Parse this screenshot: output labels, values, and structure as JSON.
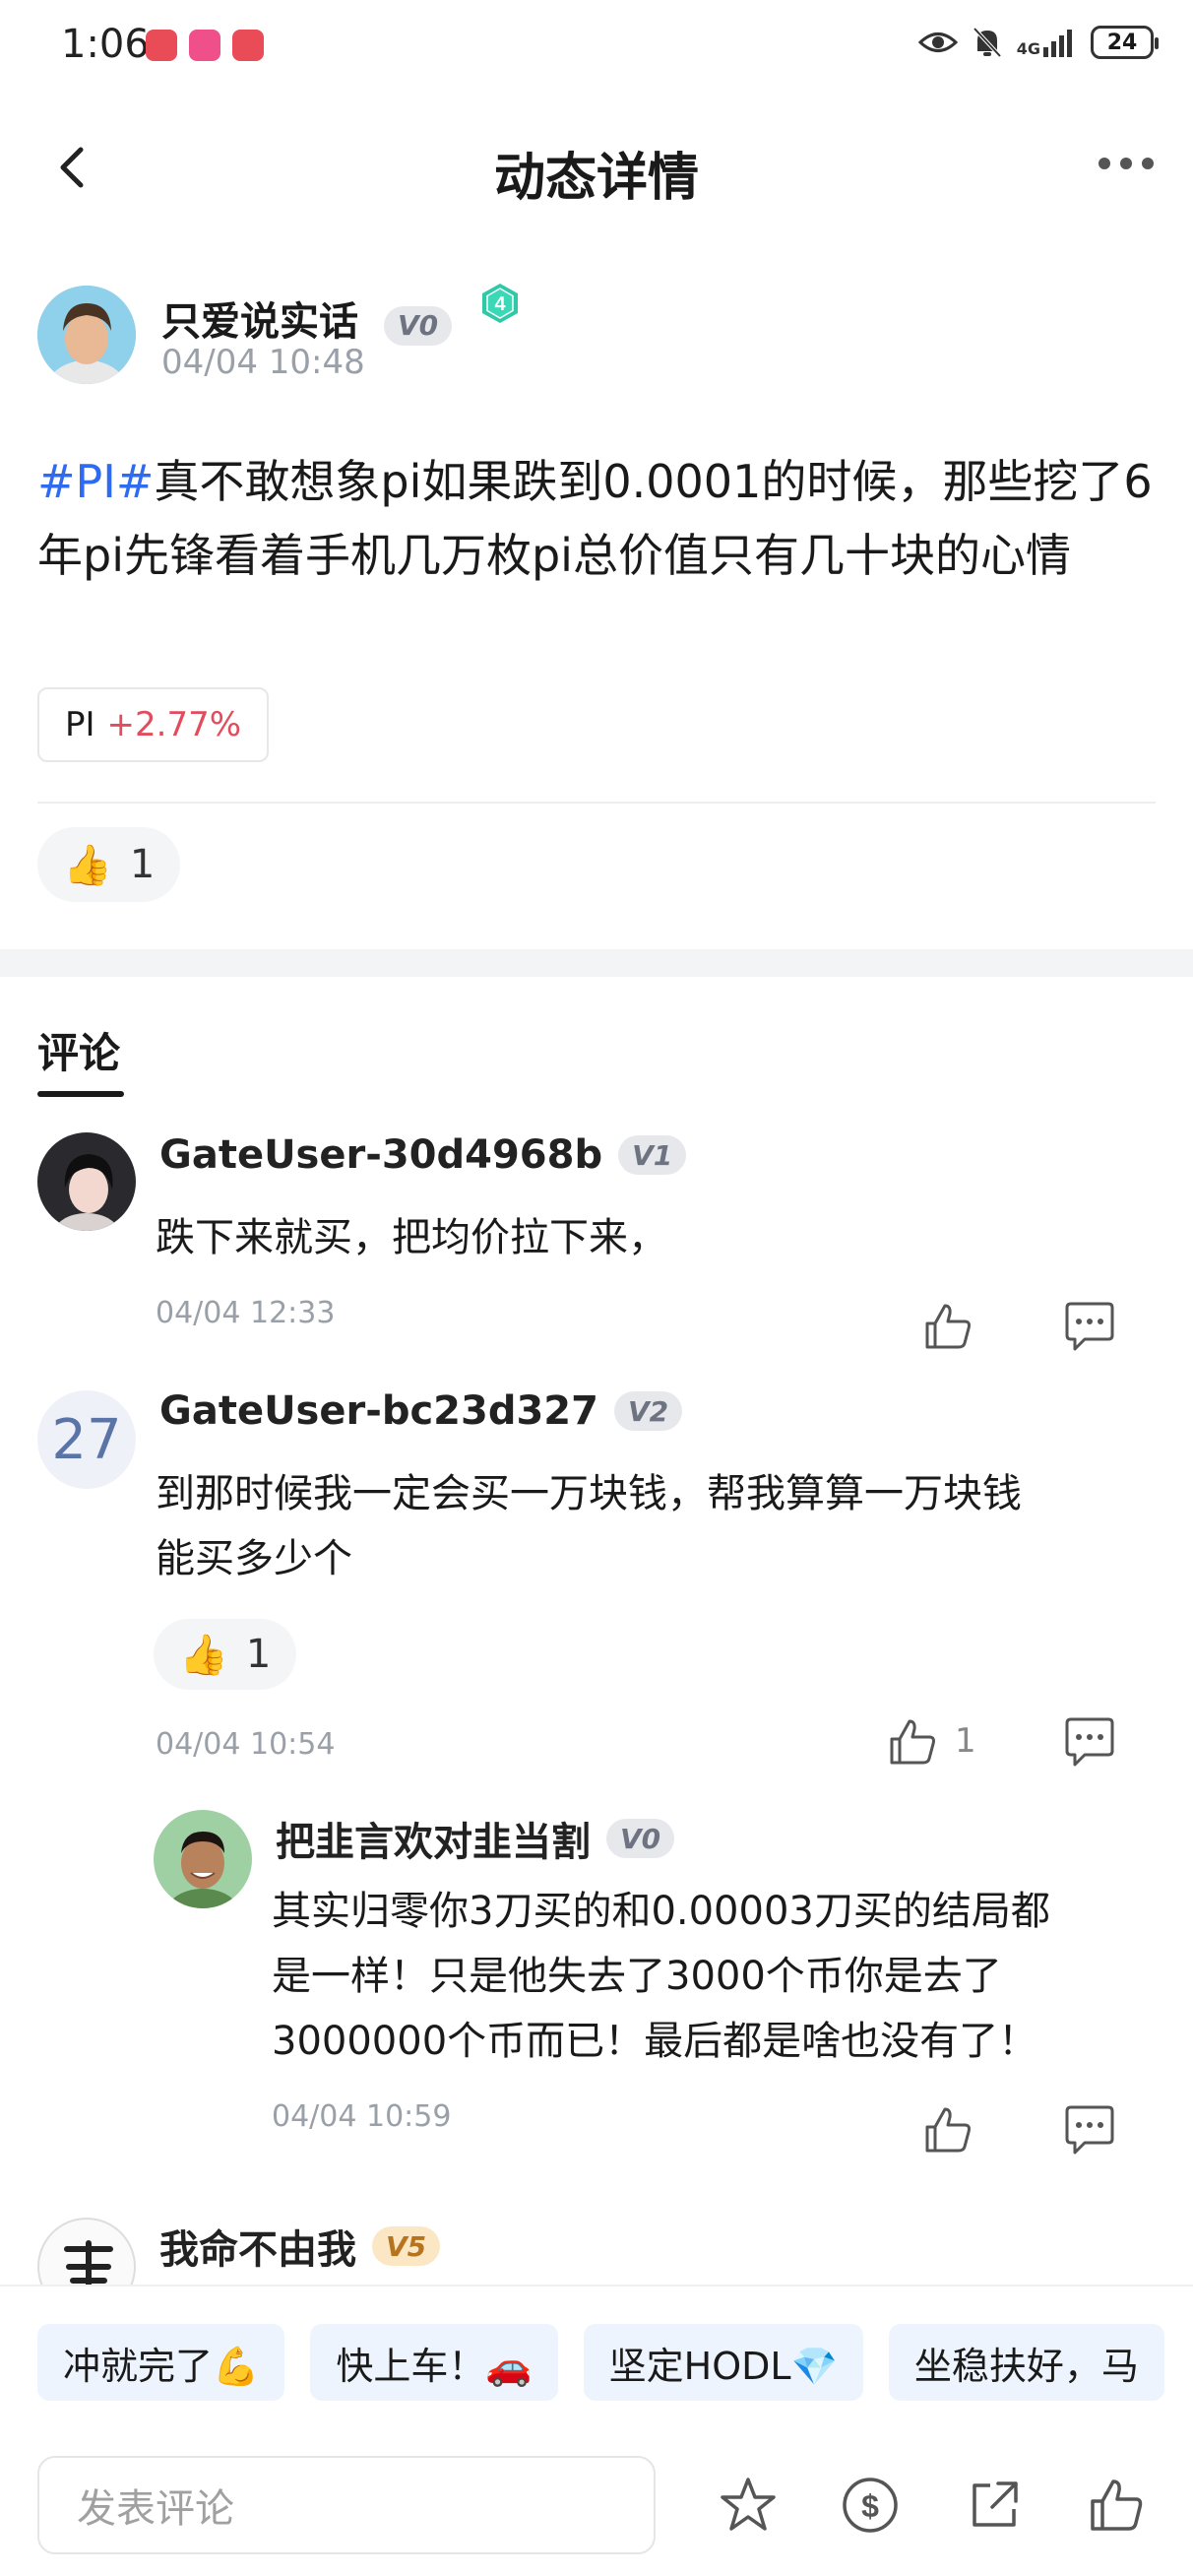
{
  "status_bar": {
    "time": "1:06",
    "network": "4G",
    "battery": "24"
  },
  "header": {
    "title": "动态详情"
  },
  "post": {
    "author_name": "只爱说实话",
    "author_level": "V0",
    "author_badge": "4",
    "date": "04/04 10:48",
    "hashtag": "#PI#",
    "text": "真不敢想象pi如果跌到0.0001的时候，那些挖了6年pi先锋看着手机几万枚pi总价值只有几十块的心情",
    "coin": {
      "name": "PI",
      "change": "+2.77%"
    },
    "reaction": {
      "emoji": "👍",
      "count": "1"
    }
  },
  "comments_title": "评论",
  "comments": [
    {
      "name": "GateUser-30d4968b",
      "level": "V1",
      "text": "跌下来就买，把均价拉下来，",
      "date": "04/04 12:33"
    },
    {
      "avatar_text": "27",
      "name": "GateUser-bc23d327",
      "level": "V2",
      "text_line1": "到那时候我一定会买一万块钱，帮我算算一万块钱",
      "text_line2": "能买多少个",
      "reaction": {
        "emoji": "👍",
        "count": "1"
      },
      "date": "04/04 10:54",
      "like_count": "1"
    },
    {
      "name": "把韭言欢对韭当割",
      "level": "V0",
      "text_line1": "其实归零你3刀买的和0.00003刀买的结局都",
      "text_line2": "是一样！只是他失去了3000个币你是去了",
      "text_line3": "3000000个币而已！最后都是啥也没有了！",
      "date": "04/04 10:59"
    },
    {
      "name": "我命不由我",
      "level": "V5"
    }
  ],
  "quick_replies": [
    "冲就完了💪",
    "快上车！🚗",
    "坚定HODL💎",
    "坐稳扶好，马"
  ],
  "input": {
    "placeholder": "发表评论"
  },
  "colors": {
    "hashtag": "#2f6bf1",
    "positive_change": "#e24c5c",
    "chip_bg": "#eef4fd"
  }
}
